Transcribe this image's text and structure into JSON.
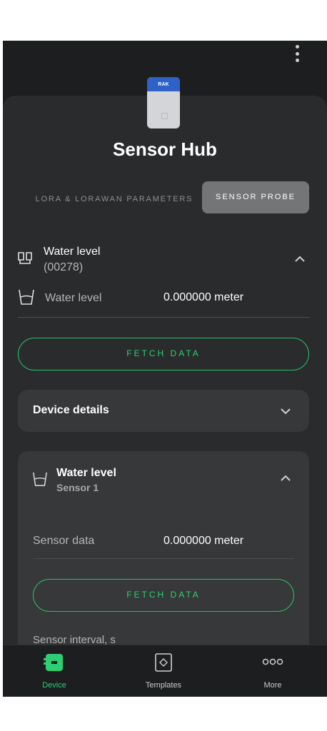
{
  "colors": {
    "accent": "#2ccf73",
    "background": "#1d1e20",
    "sheet": "#2a2b2d",
    "card": "#373839"
  },
  "header": {
    "menu_icon": "more-vert-icon"
  },
  "device": {
    "brand": "RAK",
    "title": "Sensor Hub"
  },
  "tabs": [
    {
      "label": "LORA & LORAWAN PARAMETERS",
      "active": false
    },
    {
      "label": "SENSOR PROBE",
      "active": true
    }
  ],
  "probe": {
    "name": "Water level",
    "id": "(00278)",
    "reading_label": "Water level",
    "reading_value": "0.000000 meter",
    "fetch_label": "FETCH DATA"
  },
  "device_details": {
    "label": "Device details"
  },
  "sensor_card": {
    "title": "Water level",
    "subtitle": "Sensor 1",
    "data_label": "Sensor data",
    "data_value": "0.000000 meter",
    "fetch_label": "FETCH DATA",
    "interval_label": "Sensor interval, s"
  },
  "bottom_nav": [
    {
      "label": "Device",
      "icon": "device-icon",
      "active": true
    },
    {
      "label": "Templates",
      "icon": "templates-icon",
      "active": false
    },
    {
      "label": "More",
      "icon": "more-horiz-icon",
      "active": false
    }
  ]
}
